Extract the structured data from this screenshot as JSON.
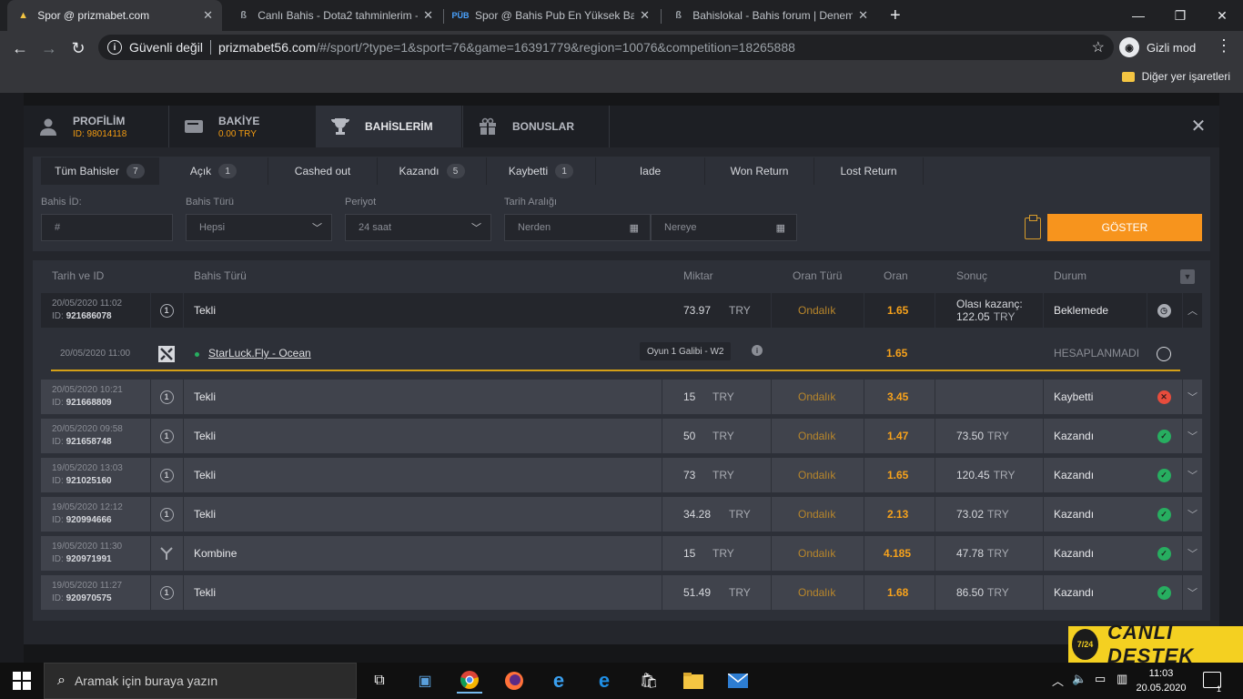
{
  "browser": {
    "tabs": [
      {
        "title": "Spor @ prizmabet.com",
        "icon": "prizmabet-favicon"
      },
      {
        "title": "Canlı Bahis - Dota2 tahminlerim -",
        "icon": "bahislokal-favicon"
      },
      {
        "title": "Spor @ Bahis Pub En Yüksek Bah",
        "icon": "pub-favicon"
      },
      {
        "title": "Bahislokal - Bahis forum | Denem",
        "icon": "bahislokal-favicon"
      }
    ],
    "security": "Güvenli değil",
    "host": "prizmabet56.com",
    "path": "/#/sport/?type=1&sport=76&game=16391779&region=10076&competition=18265888",
    "incognito": "Gizli mod",
    "bookmarks": "Diğer yer işaretleri"
  },
  "modal": {
    "tabs": [
      {
        "title": "PROFİLİM",
        "sub": "ID: 98014118",
        "icon": "user-icon"
      },
      {
        "title": "BAKİYE",
        "sub": "0.00 TRY",
        "icon": "wallet-icon"
      },
      {
        "title": "BAHİSLERİM",
        "sub": "",
        "icon": "trophy-icon"
      },
      {
        "title": "BONUSLAR",
        "sub": "",
        "icon": "gift-icon"
      }
    ],
    "filter_tabs": [
      {
        "label": "Tüm Bahisler",
        "count": "7"
      },
      {
        "label": "Açık",
        "count": "1"
      },
      {
        "label": "Cashed out",
        "count": ""
      },
      {
        "label": "Kazandı",
        "count": "5"
      },
      {
        "label": "Kaybetti",
        "count": "1"
      },
      {
        "label": "Iade",
        "count": ""
      },
      {
        "label": "Won Return",
        "count": ""
      },
      {
        "label": "Lost Return",
        "count": ""
      }
    ],
    "filters": {
      "bet_id_label": "Bahis İD:",
      "bet_id_placeholder": "#",
      "bet_type_label": "Bahis Türü",
      "bet_type_value": "Hepsi",
      "period_label": "Periyot",
      "period_value": "24 saat",
      "date_label": "Tarih Aralığı",
      "date_from": "Nerden",
      "date_to": "Nereye",
      "show_button": "GÖSTER"
    },
    "table": {
      "headers": [
        "Tarih ve ID",
        "Bahis Türü",
        "Miktar",
        "Oran Türü",
        "Oran",
        "Sonuç",
        "Durum"
      ],
      "rows": [
        {
          "date": "20/05/2020 11:02",
          "id": "921686078",
          "type": "Tekli",
          "amount": "73.97",
          "currency": "TRY",
          "odds_type": "Ondalık",
          "odds": "1.65",
          "result_label": "Olası kazanç:",
          "result": "122.05",
          "result_currency": "TRY",
          "status": "Beklemede",
          "status_icon": "clock-icon",
          "kind": "single"
        },
        {
          "date": "20/05/2020 10:21",
          "id": "921668809",
          "type": "Tekli",
          "amount": "15",
          "currency": "TRY",
          "odds_type": "Ondalık",
          "odds": "3.45",
          "result_label": "",
          "result": "",
          "result_currency": "",
          "status": "Kaybetti",
          "status_icon": "lose-icon",
          "kind": "single"
        },
        {
          "date": "20/05/2020 09:58",
          "id": "921658748",
          "type": "Tekli",
          "amount": "50",
          "currency": "TRY",
          "odds_type": "Ondalık",
          "odds": "1.47",
          "result_label": "",
          "result": "73.50",
          "result_currency": "TRY",
          "status": "Kazandı",
          "status_icon": "win-icon",
          "kind": "single"
        },
        {
          "date": "19/05/2020 13:03",
          "id": "921025160",
          "type": "Tekli",
          "amount": "73",
          "currency": "TRY",
          "odds_type": "Ondalık",
          "odds": "1.65",
          "result_label": "",
          "result": "120.45",
          "result_currency": "TRY",
          "status": "Kazandı",
          "status_icon": "win-icon",
          "kind": "single"
        },
        {
          "date": "19/05/2020 12:12",
          "id": "920994666",
          "type": "Tekli",
          "amount": "34.28",
          "currency": "TRY",
          "odds_type": "Ondalık",
          "odds": "2.13",
          "result_label": "",
          "result": "73.02",
          "result_currency": "TRY",
          "status": "Kazandı",
          "status_icon": "win-icon",
          "kind": "single"
        },
        {
          "date": "19/05/2020 11:30",
          "id": "920971991",
          "type": "Kombine",
          "amount": "15",
          "currency": "TRY",
          "odds_type": "Ondalık",
          "odds": "4.185",
          "result_label": "",
          "result": "47.78",
          "result_currency": "TRY",
          "status": "Kazandı",
          "status_icon": "win-icon",
          "kind": "combo"
        },
        {
          "date": "19/05/2020 11:27",
          "id": "920970575",
          "type": "Tekli",
          "amount": "51.49",
          "currency": "TRY",
          "odds_type": "Ondalık",
          "odds": "1.68",
          "result_label": "",
          "result": "86.50",
          "result_currency": "TRY",
          "status": "Kazandı",
          "status_icon": "win-icon",
          "kind": "single"
        }
      ],
      "id_prefix": "ID:",
      "detail": {
        "date": "20/05/2020 11:00",
        "event": "StarLuck.Fly - Ocean",
        "market": "Oyun 1 Galibi - W2",
        "odds": "1.65",
        "status": "HESAPLANMADI"
      }
    }
  },
  "live_chat": {
    "badge": "7/24",
    "label": "CANLI DESTEK"
  },
  "taskbar": {
    "search_placeholder": "Aramak için buraya yazın",
    "time": "11:03",
    "date": "20.05.2020",
    "notif_count": "1"
  },
  "colors": {
    "accent": "#f7941d",
    "odds": "#f7a21b",
    "win": "#27ae60",
    "lose": "#e74c3c"
  }
}
